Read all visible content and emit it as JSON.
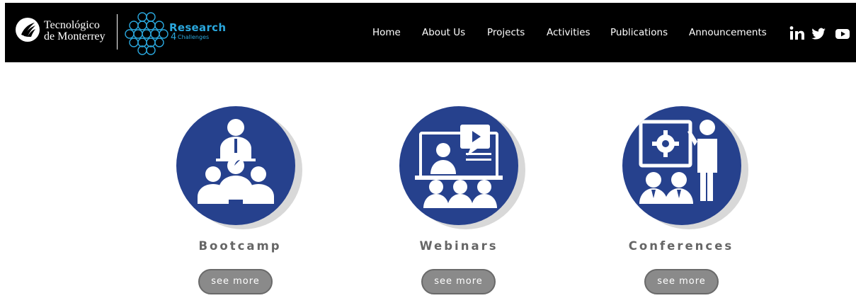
{
  "header": {
    "institution_line1": "Tecnológico",
    "institution_line2": "de Monterrey",
    "program_title": "Research",
    "program_number": "4",
    "program_subtitle": "Challenges"
  },
  "nav": {
    "items": [
      {
        "label": "Home"
      },
      {
        "label": "About Us"
      },
      {
        "label": "Projects"
      },
      {
        "label": "Activities"
      },
      {
        "label": "Publications"
      },
      {
        "label": "Announcements"
      }
    ]
  },
  "social": {
    "icons": [
      "linkedin-icon",
      "twitter-icon",
      "youtube-icon"
    ]
  },
  "cards": [
    {
      "title": "Bootcamp",
      "button": "see more",
      "icon": "presenter-audience-icon"
    },
    {
      "title": "Webinars",
      "button": "see more",
      "icon": "video-conference-icon"
    },
    {
      "title": "Conferences",
      "button": "see more",
      "icon": "presentation-board-icon"
    }
  ],
  "colors": {
    "header_bg": "#000000",
    "accent_blue": "#26418d",
    "logo_cyan": "#2aa7dd",
    "button_gray": "#8a8a8a",
    "title_gray": "#666666"
  }
}
